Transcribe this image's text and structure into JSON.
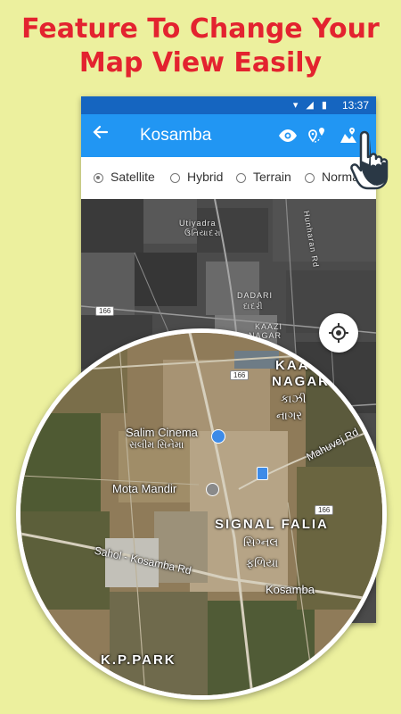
{
  "headline": {
    "line1": "Feature To Change Your",
    "line2": "Map View Easily"
  },
  "status_bar": {
    "time": "13:37",
    "icons": "▾ ◢ ▮"
  },
  "app_bar": {
    "title": "Kosamba",
    "back_icon": "arrow-back",
    "actions": [
      "eye-icon",
      "route-pin-icon",
      "map-layers-icon"
    ]
  },
  "map_types": {
    "selected": "Satellite",
    "options": [
      "Satellite",
      "Hybrid",
      "Terrain",
      "Normal"
    ]
  },
  "background_map": {
    "labels": {
      "village": "Utiyadra",
      "village_local": "ઉતિયાદરા",
      "dadari": "DADARI",
      "dadari_local": "દાદરી",
      "kaazi": "KAAZI",
      "nagar": "NAGAR",
      "hunharan": "Hunharan Rd",
      "road_166": "166"
    }
  },
  "zoom_lens": {
    "labels": {
      "kaazi_nagar_1": "KAAZI",
      "kaazi_nagar_2": "NAGAR",
      "kaazi_local_1": "કાઝી",
      "kaazi_local_2": "નાગર",
      "salim_cinema": "Salim Cinema",
      "salim_cinema_local": "સલીમ સિનેમા",
      "mota_mandir": "Mota Mandir",
      "mahuvej_rd": "Mahuvej Rd",
      "signal_falia": "SIGNAL FALIA",
      "signal_falia_local_1": "સિગ્નલ",
      "signal_falia_local_2": "ફળિયા",
      "sahol_rd": "Sahol - Kosamba Rd",
      "kosamba": "Kosamba",
      "kp_park": "K.P.PARK",
      "road_166": "166"
    }
  },
  "colors": {
    "background": "#ecf09e",
    "headline": "#e3232f",
    "app_bar": "#2196f3",
    "status_bar": "#1565c0"
  }
}
